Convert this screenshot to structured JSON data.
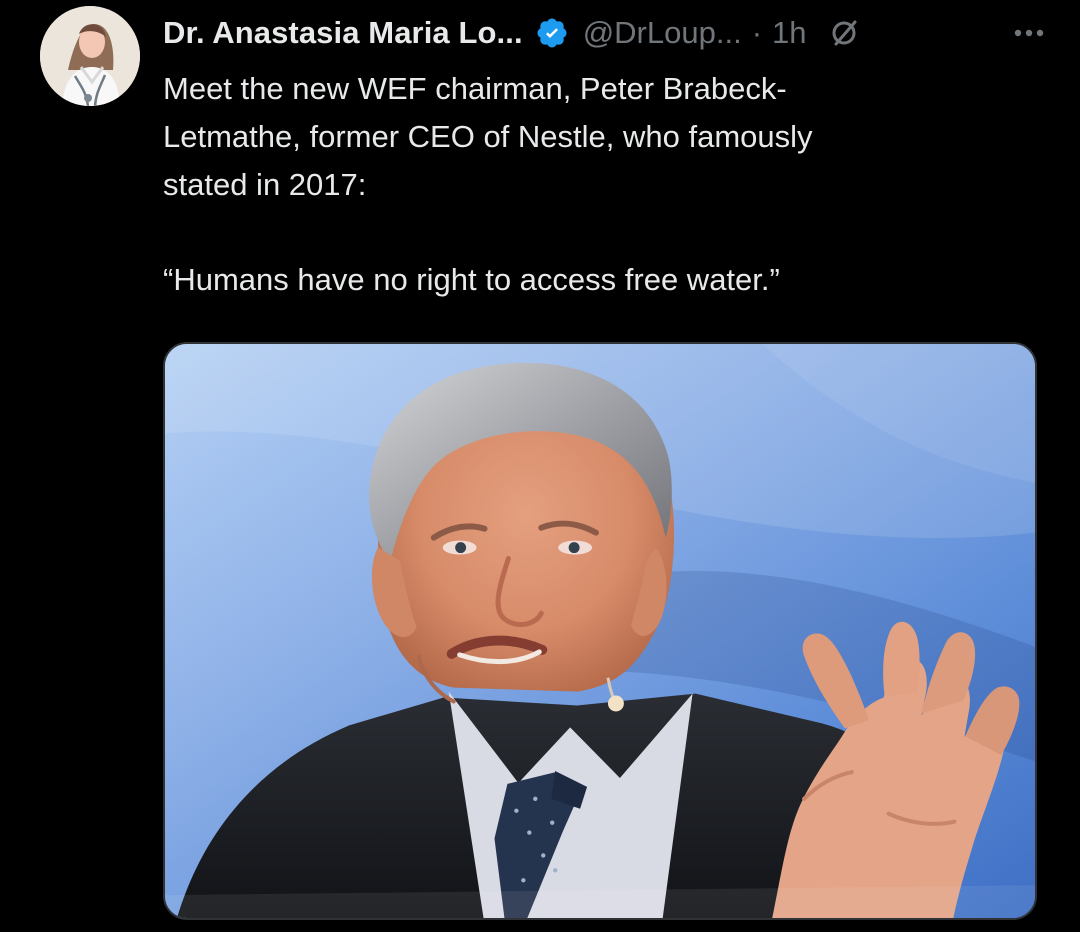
{
  "tweet": {
    "display_name": "Dr. Anastasia Maria Lo...",
    "handle": "@DrLoup...",
    "separator": "·",
    "time": "1h",
    "text_lines": [
      "Meet the new WEF chairman, Peter Brabeck-",
      "Letmathe, former CEO of Nestle, who famously",
      "stated in 2017:"
    ],
    "quote": "“Humans have no right to access free water.”"
  },
  "icons": {
    "verified": "verified-badge-icon",
    "grok": "grok-icon",
    "more": "more-options-icon"
  },
  "colors": {
    "background": "#000000",
    "text": "#e7e9ea",
    "secondary_text": "#71767b",
    "verified_blue": "#1d9bf0"
  }
}
